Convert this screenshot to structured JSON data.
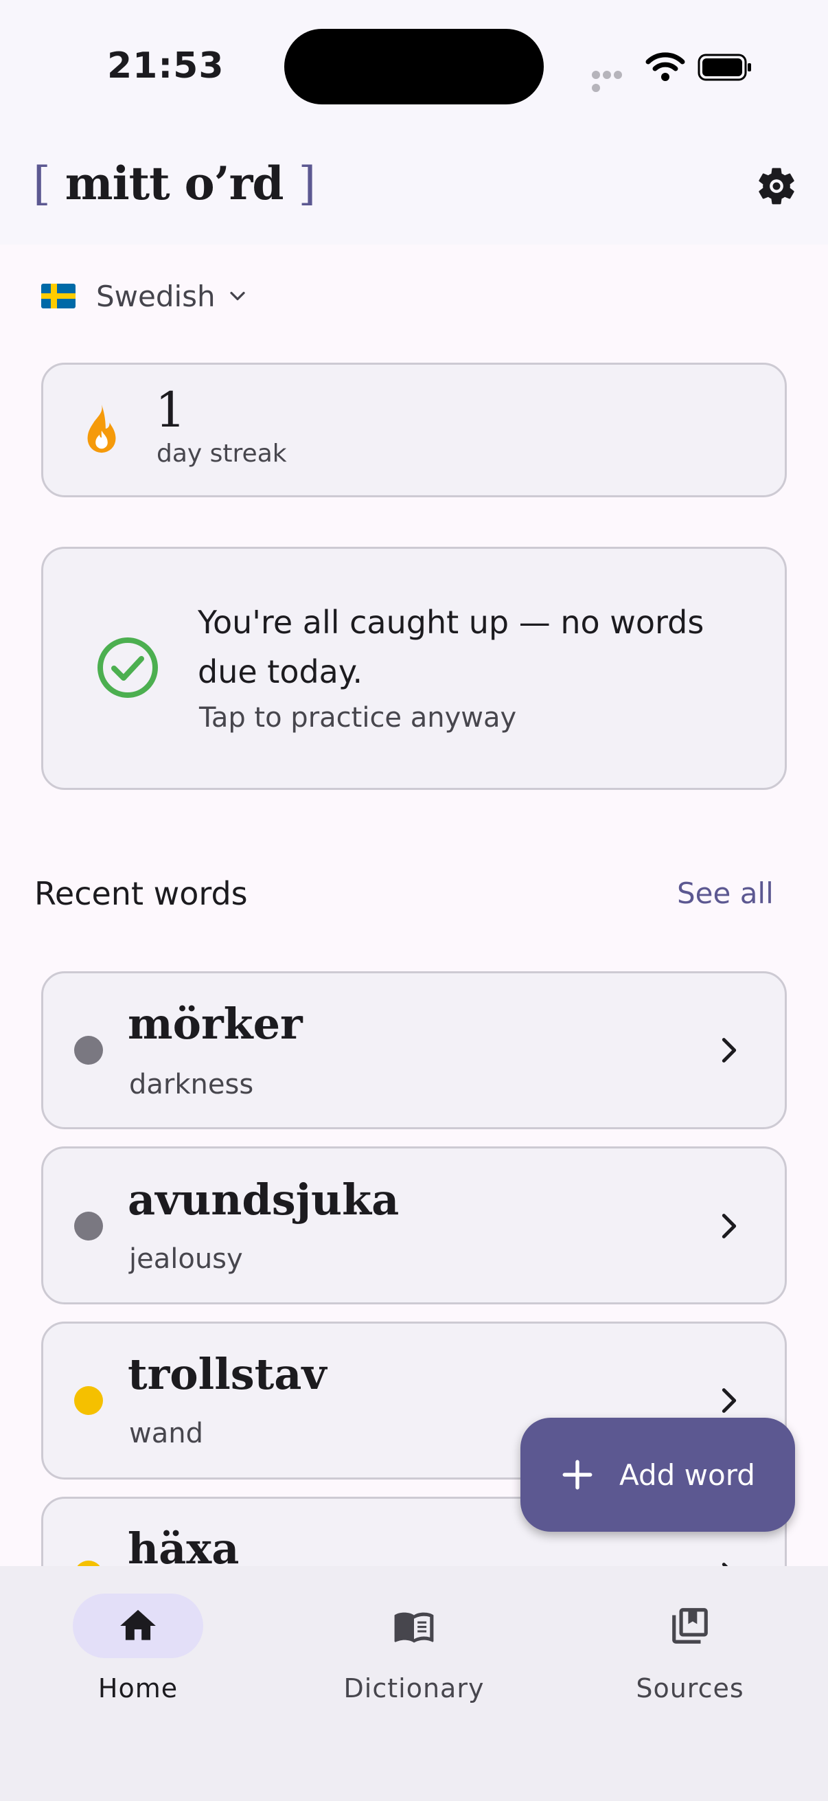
{
  "status_bar": {
    "time": "21:53"
  },
  "app": {
    "logo_open": "[",
    "logo_text": "mitt o’rd",
    "logo_close": "]"
  },
  "header": {
    "settings_icon": "gear-icon"
  },
  "language": {
    "flag": "swedish-flag",
    "label": "Swedish"
  },
  "streak": {
    "count": "1",
    "label": "day streak"
  },
  "review": {
    "title": "You're all caught up — no words due today.",
    "subtitle": "Tap to practice anyway"
  },
  "recent": {
    "title": "Recent words",
    "see_all": "See all",
    "items": [
      {
        "word": "mörker",
        "translation": "darkness",
        "status_color": "#7a7881"
      },
      {
        "word": "avundsjuka",
        "translation": "jealousy",
        "status_color": "#7a7881"
      },
      {
        "word": "trollstav",
        "translation": "wand",
        "status_color": "#f5c000"
      },
      {
        "word": "häxa",
        "translation": "",
        "status_color": "#f5c000"
      }
    ]
  },
  "fab": {
    "label": "Add word"
  },
  "nav": {
    "items": [
      {
        "label": "Home",
        "icon": "home-icon",
        "active": true
      },
      {
        "label": "Dictionary",
        "icon": "book-icon",
        "active": false
      },
      {
        "label": "Sources",
        "icon": "library-icon",
        "active": false
      }
    ]
  },
  "colors": {
    "accent": "#5c5891",
    "streak_flame": "#f59a0a",
    "success": "#4caf50"
  }
}
